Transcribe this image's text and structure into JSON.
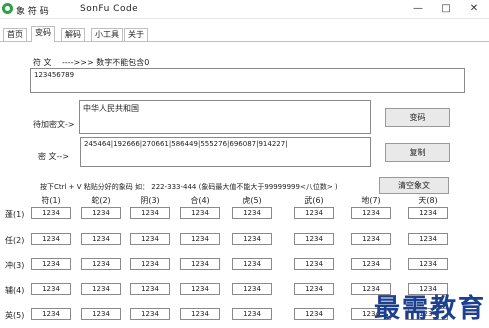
{
  "window": {
    "title": "象 符 码",
    "app_name": "SonFu Code",
    "minimize": "—",
    "maximize": "□",
    "close": "✕"
  },
  "tabs": [
    "首页",
    "变码",
    "解码",
    "小工具",
    "关于"
  ],
  "form": {
    "symbol_label": "符 文",
    "symbol_hint": "---->>> 数字不能包含0",
    "symbol_value": "123456789",
    "encrypt_label": "待加密文->",
    "encrypt_value": "中华人民共和国",
    "cipher_label": "密 文-->",
    "cipher_value": "245464|192666|270661|586449|555276|696087|914227|",
    "encode_button": "变码",
    "copy_button": "复制",
    "info_text": "按下Ctrl + V 粘贴分好的象码 如： 222-333-444  (象码最大值不能大于99999999<八位数> )",
    "clear_button": "清空象文"
  },
  "grid": {
    "columns": [
      "符(1)",
      "蛇(2)",
      "阴(3)",
      "合(4)",
      "虎(5)",
      "武(6)",
      "地(7)",
      "天(8)"
    ],
    "rows": [
      "蓬(1)",
      "任(2)",
      "冲(3)",
      "辅(4)",
      "英(5)"
    ],
    "cell_value": "1234"
  },
  "watermark": "最需教育"
}
